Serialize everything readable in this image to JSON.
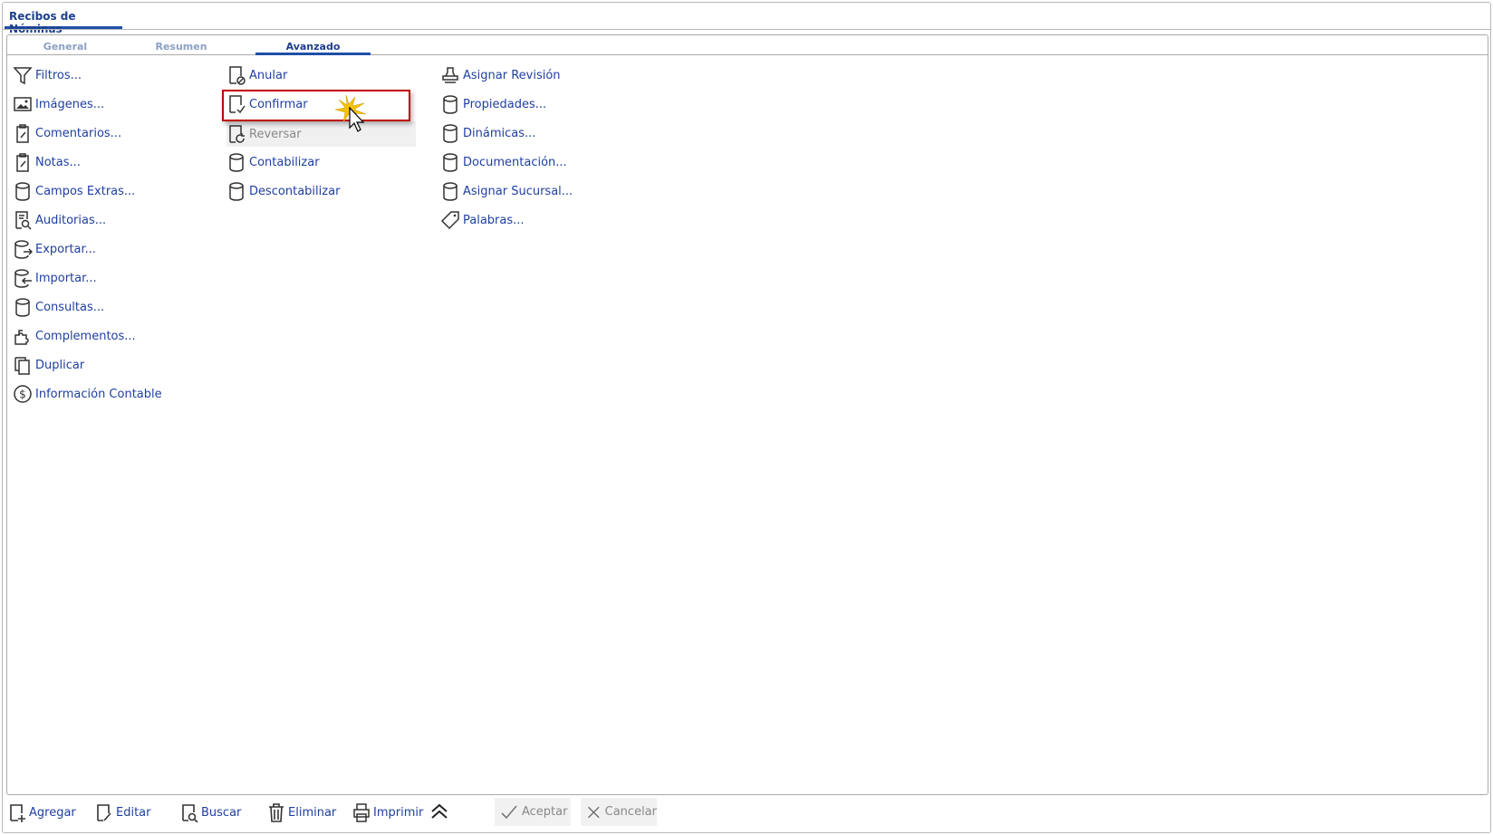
{
  "window_tab": "Recibos de Nóminas",
  "tabs": [
    "General",
    "Resumen",
    "Avanzado"
  ],
  "active_tab": "Avanzado",
  "col1": [
    "Filtros...",
    "Imágenes...",
    "Comentarios...",
    "Notas...",
    "Campos Extras...",
    "Auditorias...",
    "Exportar...",
    "Importar...",
    "Consultas...",
    "Complementos...",
    "Duplicar",
    "Información Contable"
  ],
  "col2": [
    "Anular",
    "Confirmar",
    "Reversar",
    "Contabilizar",
    "Descontabilizar"
  ],
  "col3": [
    "Asignar Revisión",
    "Propiedades...",
    "Dinámicas...",
    "Documentación...",
    "Asignar Sucursal...",
    "Palabras..."
  ],
  "footer": {
    "agregar": "Agregar",
    "editar": "Editar",
    "buscar": "Buscar",
    "eliminar": "Eliminar",
    "imprimir": "Imprimir",
    "aceptar": "Aceptar",
    "cancelar": "Cancelar"
  },
  "colors": {
    "link": "#1f3fa0",
    "accent": "#1f4fa8",
    "highlight": "#c00000"
  }
}
